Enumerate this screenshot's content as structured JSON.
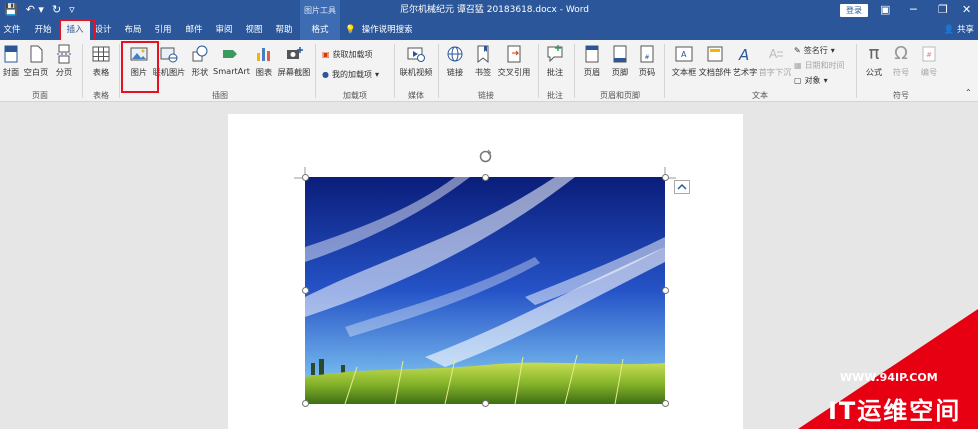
{
  "titlebar": {
    "picture_tools": "图片工具",
    "doc_title": "尼尔机械纪元 谭召猛 20183618.docx - Word",
    "login": "登录",
    "ribbon_display_icon": "ribbon-display-icon",
    "restore_icon": "restore-icon",
    "close_icon": "close-icon"
  },
  "quick_access": {
    "save_icon": "save-icon",
    "undo_icon": "undo-icon",
    "redo_icon": "redo-icon",
    "customize_icon": "customize-icon"
  },
  "tabs": [
    {
      "label": "文件"
    },
    {
      "label": "开始"
    },
    {
      "label": "插入"
    },
    {
      "label": "设计"
    },
    {
      "label": "布局"
    },
    {
      "label": "引用"
    },
    {
      "label": "邮件"
    },
    {
      "label": "审阅"
    },
    {
      "label": "视图"
    },
    {
      "label": "帮助"
    },
    {
      "label": "格式"
    }
  ],
  "tell_me": "操作说明搜索",
  "share": "共享",
  "ribbon": {
    "pages": {
      "cover": "封面",
      "blank": "空白页",
      "break": "分页",
      "group": "页面"
    },
    "tables": {
      "table": "表格",
      "group": "表格"
    },
    "illustrations": {
      "picture": "图片",
      "online_picture": "联机图片",
      "shapes": "形状",
      "smartart": "SmartArt",
      "chart": "图表",
      "screenshot": "屏幕截图",
      "group": "插图"
    },
    "addins": {
      "get": "获取加载项",
      "my": "我的加载项",
      "group": "加载项"
    },
    "media": {
      "online_video": "联机视频",
      "group": "媒体"
    },
    "links": {
      "link": "链接",
      "bookmark": "书签",
      "cross_ref": "交叉引用",
      "group": "链接"
    },
    "comments": {
      "comment": "批注",
      "group": "批注"
    },
    "header_footer": {
      "header": "页眉",
      "footer": "页脚",
      "page_number": "页码",
      "group": "页眉和页脚"
    },
    "text": {
      "textbox": "文本框",
      "quick_parts": "文档部件",
      "wordart": "艺术字",
      "dropcap": "首字下沉",
      "signature": "签名行",
      "datetime": "日期和时间",
      "object": "对象",
      "group": "文本"
    },
    "symbols": {
      "equation": "公式",
      "symbol": "符号",
      "number": "编号",
      "group": "符号"
    }
  },
  "watermark": {
    "url": "WWW.94IP.COM",
    "brand": "IT运维空间"
  },
  "colors": {
    "word_blue": "#2b579a",
    "highlight_red": "#e81123"
  }
}
